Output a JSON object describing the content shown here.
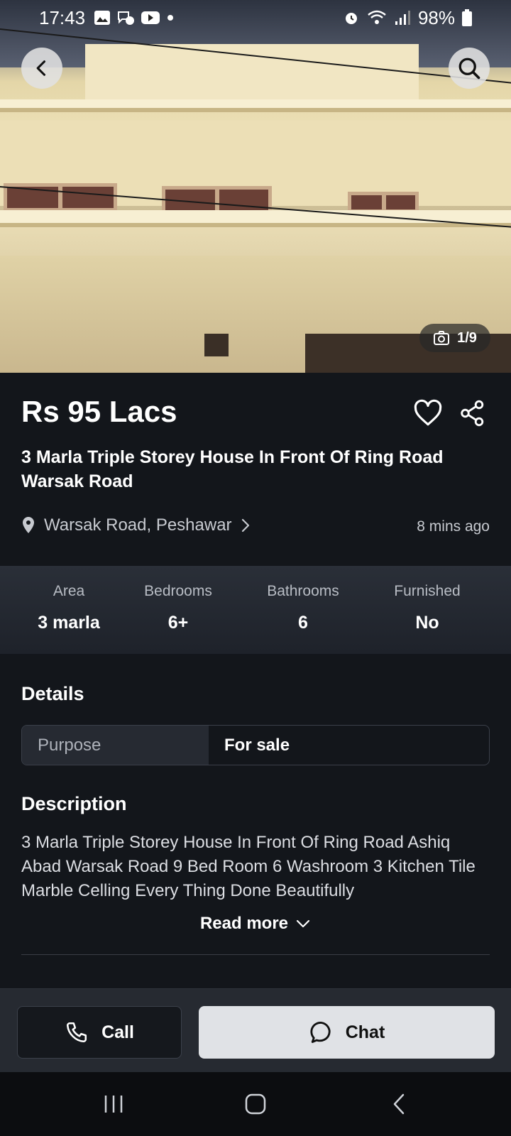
{
  "status_bar": {
    "time": "17:43",
    "battery": "98%"
  },
  "hero": {
    "photo_counter": "1/9"
  },
  "listing": {
    "price": "Rs 95 Lacs",
    "title": "3 Marla Triple Storey House In Front Of Ring Road Warsak Road",
    "location": "Warsak Road, Peshawar",
    "posted_ago": "8 mins ago"
  },
  "specs": [
    {
      "label": "Area",
      "value": "3 marla"
    },
    {
      "label": "Bedrooms",
      "value": "6+"
    },
    {
      "label": "Bathrooms",
      "value": "6"
    },
    {
      "label": "Furnished",
      "value": "No"
    }
  ],
  "details": {
    "heading": "Details",
    "rows": [
      {
        "key": "Purpose",
        "value": "For sale"
      }
    ]
  },
  "description": {
    "heading": "Description",
    "text": "3 Marla Triple Storey House In Front Of Ring Road Ashiq Abad Warsak Road 9 Bed Room 6 Washroom 3 Kitchen Tile Marble Celling Every Thing Done Beautifully",
    "read_more": "Read more"
  },
  "actions": {
    "call": "Call",
    "chat": "Chat"
  },
  "icons": [
    "back-icon",
    "search-icon",
    "camera-icon",
    "heart-icon",
    "share-icon",
    "location-pin-icon",
    "chevron-right-icon",
    "chevron-down-icon",
    "phone-icon",
    "chat-bubble-icon",
    "recents-icon",
    "home-icon",
    "nav-back-icon"
  ],
  "colors": {
    "background": "#13161b",
    "specs_band": "#2a2f38",
    "chat_button": "#e0e2e6"
  }
}
